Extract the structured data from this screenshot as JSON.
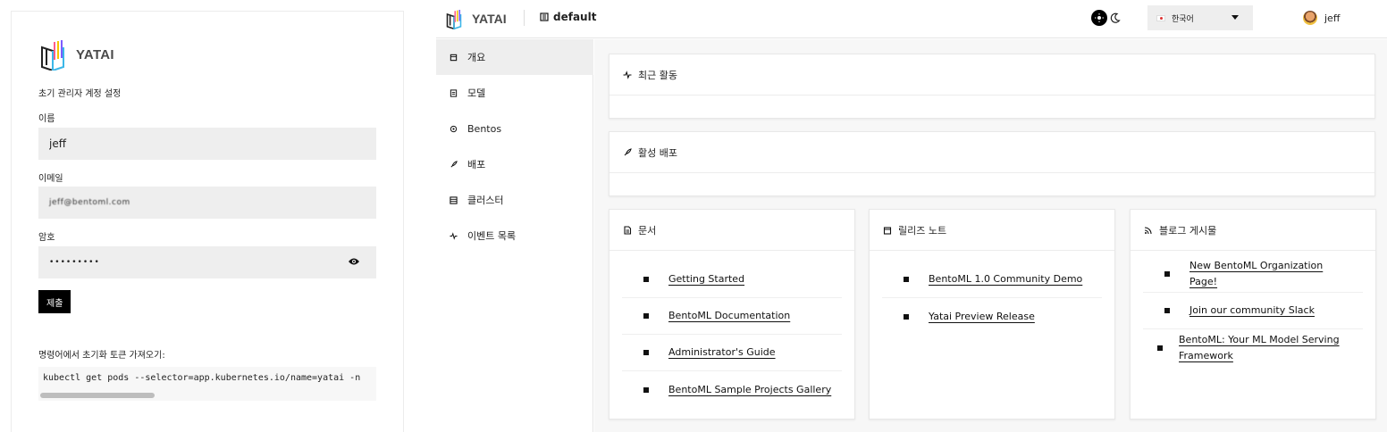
{
  "setup": {
    "brand": "YATAI",
    "title": "초기 관리자 계정 설정",
    "name_label": "이름",
    "name_value": "jeff",
    "email_label": "이메일",
    "email_value": "jeff@bentoml.com",
    "password_label": "암호",
    "password_value": "•••••••••",
    "submit_label": "제출",
    "cmd_label": "명령어에서 초기화 토큰 가져오기:",
    "cmd_text": "kubectl get pods --selector=app.kubernetes.io/name=yatai -n"
  },
  "header": {
    "brand": "YATAI",
    "org_name": "default",
    "language": "한국어",
    "username": "jeff"
  },
  "sidebar": {
    "items": [
      {
        "label": "개요",
        "icon": "overview-icon",
        "active": true
      },
      {
        "label": "모델",
        "icon": "model-icon",
        "active": false
      },
      {
        "label": "Bentos",
        "icon": "bento-icon",
        "active": false
      },
      {
        "label": "배포",
        "icon": "rocket-icon",
        "active": false
      },
      {
        "label": "클러스터",
        "icon": "cluster-icon",
        "active": false
      },
      {
        "label": "이벤트 목록",
        "icon": "activity-icon",
        "active": false
      }
    ]
  },
  "main": {
    "recent_activity_title": "최근 활동",
    "active_deployments_title": "활성 배포",
    "docs": {
      "title": "문서",
      "links": [
        "Getting Started",
        "BentoML Documentation",
        "Administrator's Guide",
        "BentoML Sample Projects Gallery"
      ]
    },
    "release_notes": {
      "title": "릴리즈 노트",
      "links": [
        "BentoML 1.0 Community Demo",
        "Yatai Preview Release"
      ]
    },
    "blog": {
      "title": "블로그 게시물",
      "links": [
        "New BentoML Organization Page!",
        "Join our community Slack",
        "BentoML: Your ML Model Serving Framework"
      ]
    }
  },
  "colors": {
    "logo": [
      "#ff5c8a",
      "#f5c400",
      "#3bb7e8",
      "#7d5cff",
      "#222222"
    ],
    "accent": "#000000",
    "field_bg": "#eeeeee"
  }
}
